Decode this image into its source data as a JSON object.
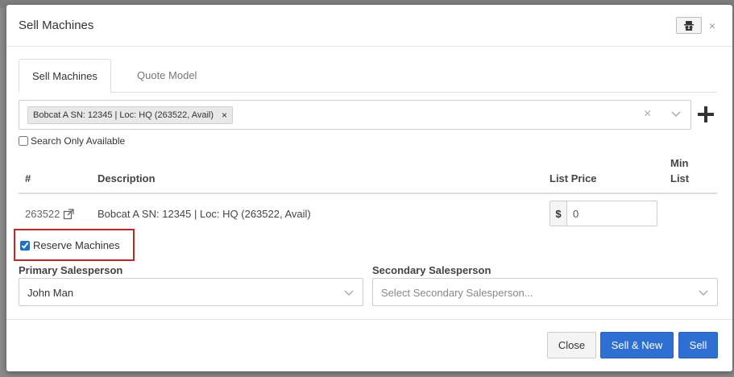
{
  "modal": {
    "title": "Sell Machines",
    "close_glyph": "×"
  },
  "tabs": [
    {
      "label": "Sell Machines"
    },
    {
      "label": "Quote Model"
    }
  ],
  "machine_select": {
    "chip_label": "Bobcat A SN: 12345 | Loc: HQ (263522, Avail)",
    "chip_remove": "×",
    "clear": "×"
  },
  "search_only_available": {
    "label": "Search Only Available",
    "checked": false
  },
  "table": {
    "headers": {
      "num": "#",
      "description": "Description",
      "list_price": "List Price",
      "min_list_1": "Min",
      "min_list_2": "List"
    },
    "rows": [
      {
        "id": "263522",
        "description": "Bobcat A SN: 12345 | Loc: HQ (263522, Avail)",
        "price_prefix": "$",
        "price": "0"
      }
    ]
  },
  "reserve_machines": {
    "label": "Reserve Machines",
    "checked": true
  },
  "primary_salesperson": {
    "label": "Primary Salesperson",
    "value": "John Man"
  },
  "secondary_salesperson": {
    "label": "Secondary Salesperson",
    "placeholder": "Select Secondary Salesperson..."
  },
  "footer": {
    "close_label": "Close",
    "sell_new_label": "Sell & New",
    "sell_label": "Sell"
  },
  "colors": {
    "primary": "#2e6fd4",
    "highlight_border": "#cc2222"
  }
}
